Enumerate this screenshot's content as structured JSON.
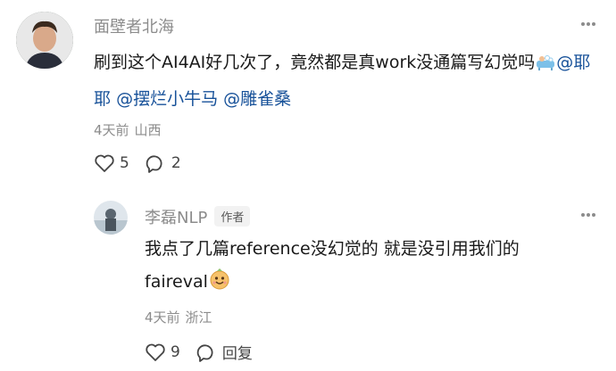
{
  "comments": [
    {
      "author": "面壁者北海",
      "text_before": "刷到这个AI4AI好几次了，竟然都是真work没通篇写幻觉吗",
      "mentions": [
        "@耶耶",
        "@摆烂小牛马",
        "@雕雀桑"
      ],
      "emoji": "bathtub-emoji",
      "time": "4天前",
      "location": "山西",
      "likes": "5",
      "replies": "2"
    },
    {
      "author": "李磊NLP",
      "badge": "作者",
      "text_line1": "我点了几篇reference没幻觉的 就是没引用我们的",
      "text_line2": "faireval",
      "emoji": "hugging-face-emoji",
      "time": "4天前",
      "location": "浙江",
      "likes": "9",
      "reply_label": "回复"
    }
  ]
}
